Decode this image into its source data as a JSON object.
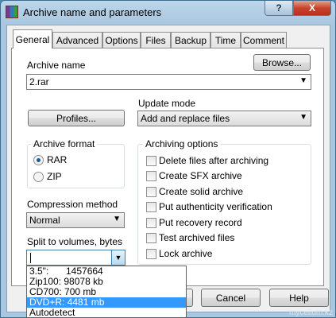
{
  "window": {
    "title": "Archive name and parameters",
    "help_label": "?",
    "close_label": "X"
  },
  "tabs": [
    {
      "label": "General",
      "active": true
    },
    {
      "label": "Advanced"
    },
    {
      "label": "Options"
    },
    {
      "label": "Files"
    },
    {
      "label": "Backup"
    },
    {
      "label": "Time"
    },
    {
      "label": "Comment"
    }
  ],
  "general": {
    "archive_name_label": "Archive name",
    "browse_label": "Browse...",
    "archive_name_value": "2.rar",
    "profiles_label": "Profiles...",
    "update_mode_label": "Update mode",
    "update_mode_value": "Add and replace files",
    "archive_format": {
      "title": "Archive format",
      "options": [
        "RAR",
        "ZIP"
      ],
      "selected": "RAR"
    },
    "compression_label": "Compression method",
    "compression_value": "Normal",
    "split_label": "Split to volumes, bytes",
    "split_value": "",
    "split_options": [
      {
        "name": "3.5\":",
        "size": "1457664"
      },
      {
        "name": "Zip100:",
        "size": "98078 kb"
      },
      {
        "name": "CD700:",
        "size": "700 mb"
      },
      {
        "name": "DVD+R:",
        "size": "4481 mb",
        "highlighted": true
      },
      {
        "name": "Autodetect",
        "size": ""
      }
    ],
    "archiving_options": {
      "title": "Archiving options",
      "items": [
        {
          "label": "Delete files after archiving",
          "checked": false
        },
        {
          "label": "Create SFX archive",
          "checked": false
        },
        {
          "label": "Create solid archive",
          "checked": false
        },
        {
          "label": "Put authenticity verification",
          "checked": false
        },
        {
          "label": "Put recovery record",
          "checked": false
        },
        {
          "label": "Test archived files",
          "checked": false
        },
        {
          "label": "Lock archive",
          "checked": false
        }
      ]
    }
  },
  "footer": {
    "cancel_label": "Cancel",
    "help_label": "Help"
  },
  "watermark": "mycelium.kz"
}
